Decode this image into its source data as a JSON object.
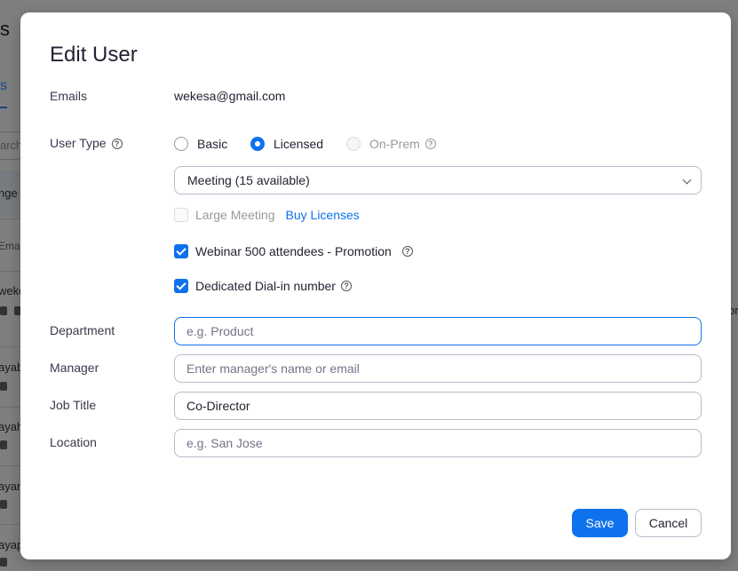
{
  "background": {
    "title_fragment": "s",
    "tab_fragment": "s",
    "search_fragment": "arch",
    "row_fragments": [
      "nge",
      "Emai",
      "weke",
      "ayab",
      "ayah",
      "ayan",
      "ayap"
    ],
    "right_fragment": "on"
  },
  "modal": {
    "title": "Edit User",
    "emails_label": "Emails",
    "email_value": "wekesa@gmail.com",
    "user_type_label": "User Type",
    "user_type_options": [
      "Basic",
      "Licensed",
      "On-Prem"
    ],
    "user_type_selected": "Licensed",
    "meeting_select": "Meeting (15 available)",
    "large_meeting_label": "Large Meeting",
    "buy_licenses_link": "Buy Licenses",
    "webinar_label": "Webinar 500 attendees - Promotion",
    "webinar_checked": true,
    "dial_in_label": "Dedicated Dial-in number",
    "dial_in_checked": true,
    "department_label": "Department",
    "department_placeholder": "e.g. Product",
    "department_value": "",
    "manager_label": "Manager",
    "manager_placeholder": "Enter manager's name or email",
    "manager_value": "",
    "job_title_label": "Job Title",
    "job_title_value": "Co-Director",
    "location_label": "Location",
    "location_placeholder": "e.g. San Jose",
    "location_value": "",
    "save_label": "Save",
    "cancel_label": "Cancel",
    "help_glyph": "?"
  },
  "colors": {
    "accent": "#0e72ed",
    "overlay": "rgba(0,0,0,0.5)"
  }
}
